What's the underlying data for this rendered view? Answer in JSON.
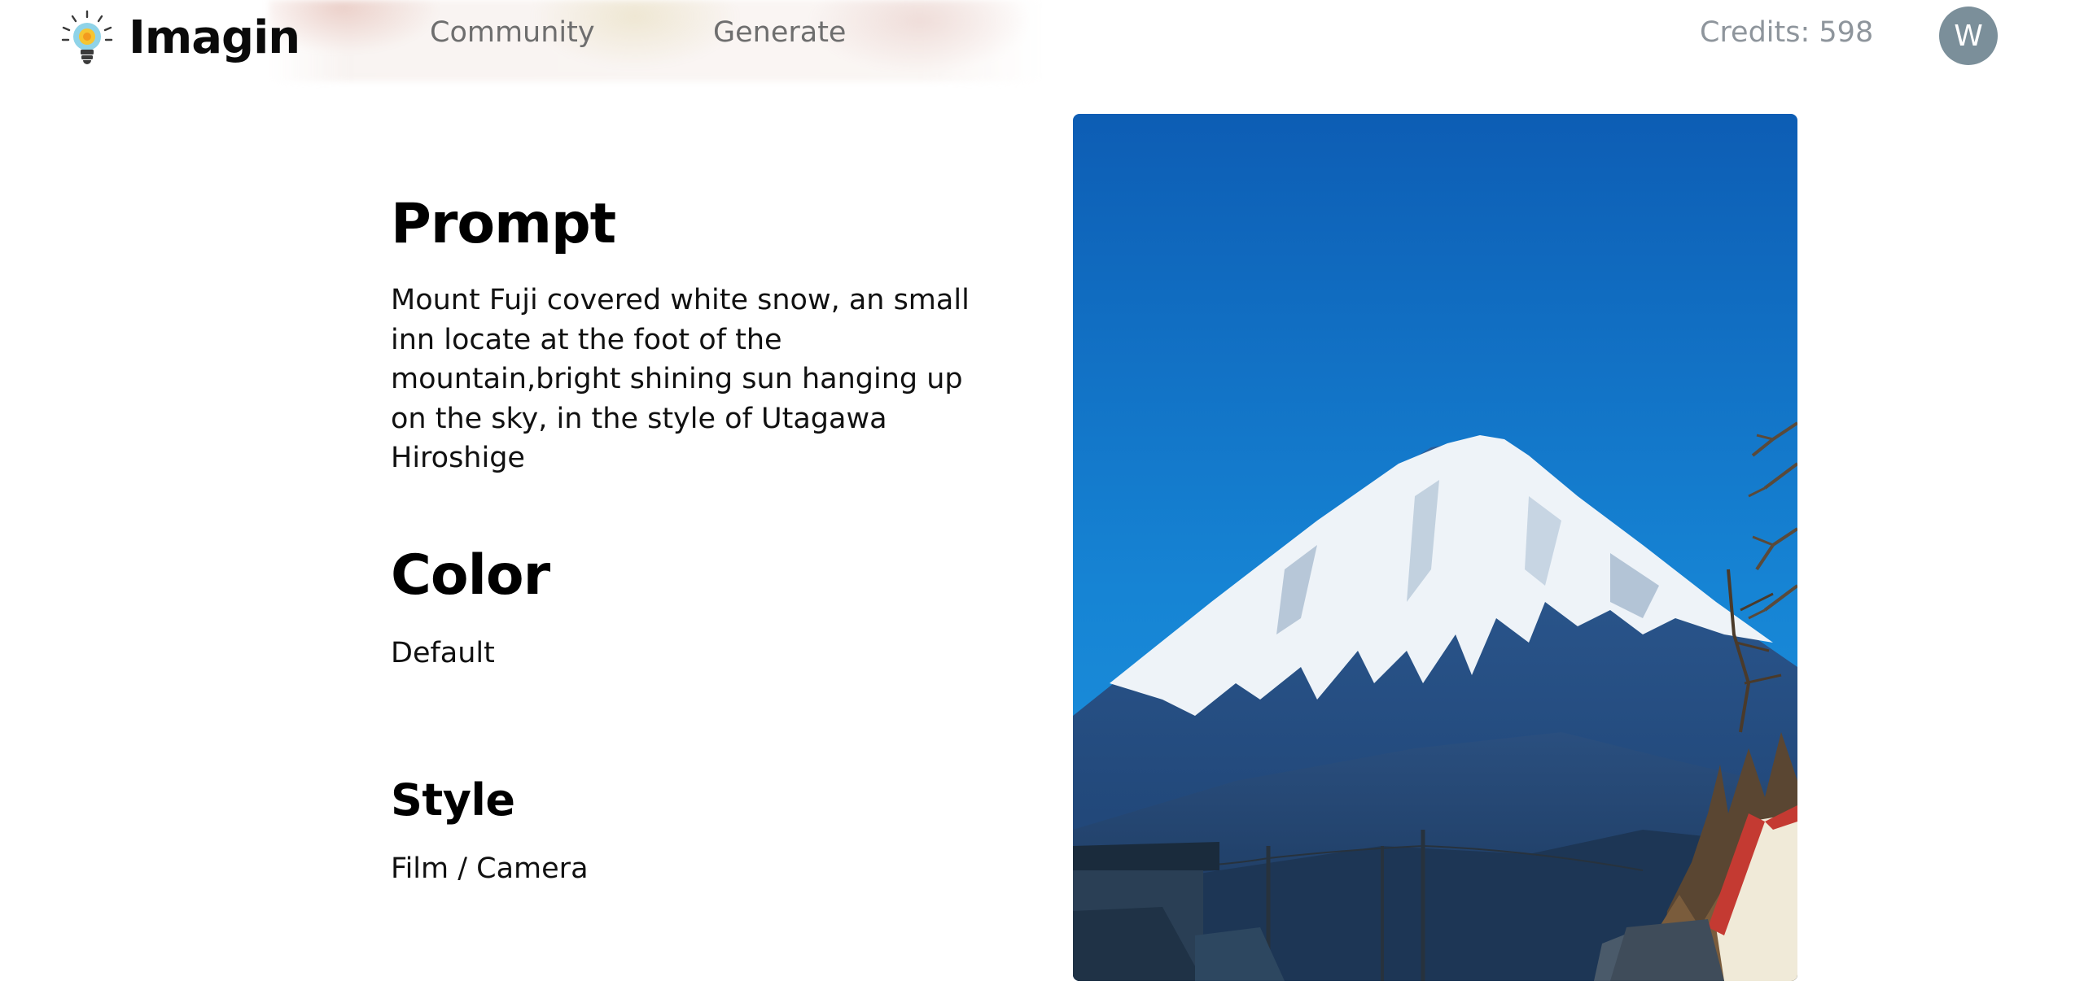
{
  "header": {
    "logo_icon": "lightbulb-icon",
    "logo_text": "Imagin",
    "nav": [
      {
        "label": "Community"
      },
      {
        "label": "Generate"
      }
    ],
    "credits": "Credits: 598",
    "avatar_initial": "W"
  },
  "details": {
    "prompt": {
      "title": "Prompt",
      "value": "Mount Fuji covered white snow, an small inn locate at the foot of the mountain,bright shining sun hanging up on the sky, in the style of Utagawa Hiroshige"
    },
    "color": {
      "title": "Color",
      "value": "Default"
    },
    "style": {
      "title": "Style",
      "value": "Film / Camera"
    }
  },
  "image": {
    "subject": "generated-image-mount-fuji"
  },
  "colors": {
    "avatar_bg": "#7b8f9a",
    "nav_text": "#6e6e6e",
    "credits_text": "#8e959c",
    "sky_top": "#0b57b0",
    "sky_bottom": "#1a8ad8"
  }
}
